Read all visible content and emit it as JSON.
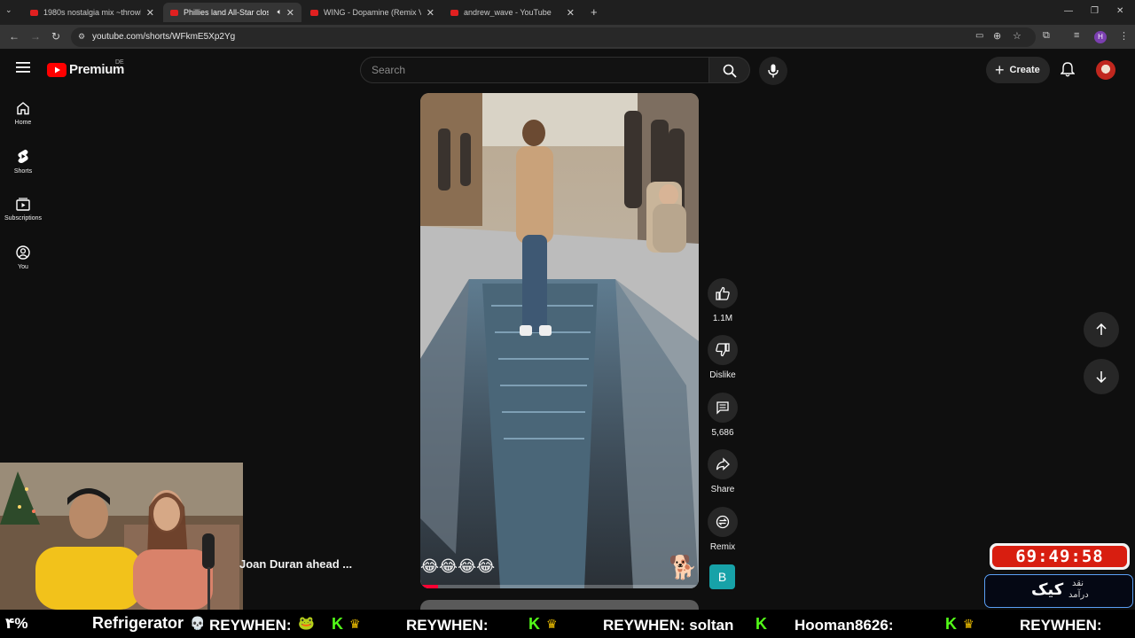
{
  "browser": {
    "tabs": [
      {
        "title": "1980s nostalgia mix ~throwbac",
        "active": false
      },
      {
        "title": "Phillies land All-Star closer",
        "active": true
      },
      {
        "title": "WING - Dopamine (Remix VER.",
        "active": false
      },
      {
        "title": "andrew_wave - YouTube",
        "active": false
      }
    ],
    "url": "youtube.com/shorts/WFkmE5Xp2Yg",
    "profile_initial": "H"
  },
  "youtube": {
    "logo_text": "Premium",
    "region": "DE",
    "search_placeholder": "Search",
    "create_label": "Create",
    "sidebar": [
      {
        "label": "Home",
        "icon": "home-icon"
      },
      {
        "label": "Shorts",
        "icon": "shorts-icon"
      },
      {
        "label": "Subscriptions",
        "icon": "subscriptions-icon"
      },
      {
        "label": "You",
        "icon": "you-icon"
      }
    ],
    "actions": {
      "like_count": "1.1M",
      "dislike_label": "Dislike",
      "comments_count": "5,686",
      "share_label": "Share",
      "remix_label": "Remix",
      "channel_avatar_letter": "B"
    },
    "video_emojis": "😂😂😂😂"
  },
  "stream": {
    "side_caption": "Joan Duran ahead ...",
    "ticker_left_text": "۴%",
    "ticker_product": "Refrigerator",
    "ticker_items": [
      "REYWHEN:",
      "REYWHEN:",
      "REYWHEN: soltan",
      "Hooman8626:",
      "REYWHEN:"
    ],
    "timer": "69:49:58",
    "kick_box": {
      "main": "کیک",
      "line1": "نقد",
      "line2": "درآمد"
    }
  },
  "colors": {
    "brand_red": "#ff0000",
    "timer_red": "#d81e10",
    "kick_green": "#53fc18"
  }
}
